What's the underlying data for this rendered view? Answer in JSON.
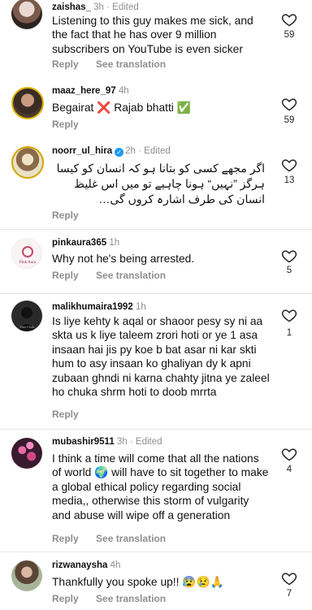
{
  "comments": [
    {
      "user": "zaishas_",
      "meta": "3h · Edited",
      "text": "Listening to this guy makes me sick, and the fact that he has over 9 million subscribers on YouTube is even sicker",
      "reply": "Reply",
      "see_translation": "See translation",
      "likes": "59"
    },
    {
      "user": "maaz_here_97",
      "meta": "4h",
      "text": "Begairat ❌ Rajab bhatti ✅",
      "reply": "Reply",
      "likes": "59"
    },
    {
      "user": "noorr_ul_hira",
      "meta": "2h · Edited",
      "text": "اگر مجھے کسی کو بتانا ہو کہ انسان کو کیسا ہرگز ”نہیں“ ہونا چاہیے تو میں اس غلیظ انسان کی طرف اشارہ کروں گی…",
      "reply": "Reply",
      "likes": "13"
    },
    {
      "user": "pinkaura365",
      "meta": "1h",
      "text": "Why not he's being arrested.",
      "reply": "Reply",
      "see_translation": "See translation",
      "likes": "5"
    },
    {
      "user": "malikhumaira1992",
      "meta": "1h",
      "text": "Is liye kehty k aqal or shaoor pesy sy ni aa skta us k liye taleem zrori hoti  or ye 1 asa insaan hai jis py koe b bat asar ni kar skti hum to asy insaan ko ghaliyan dy k apni zubaan ghndi ni karna chahty jitna ye zaleel ho chuka  shrm hoti to doob mrrta",
      "reply": "Reply",
      "likes": "1"
    },
    {
      "user": "mubashir9511",
      "meta": "3h · Edited",
      "text": "I think a time will come that all the nations of world 🌍 will have to sit together to make a global ethical policy regarding social media,, otherwise this storm of vulgarity and abuse will wipe off a generation",
      "reply": "Reply",
      "see_translation": "See translation",
      "likes": "4"
    },
    {
      "user": "rizwanaysha",
      "meta": "4h",
      "text": "Thankfully you spoke up!! 😰😢🙏",
      "reply": "Reply",
      "see_translation": "See translation",
      "likes": "7"
    }
  ],
  "colors": {
    "text": "#111111",
    "meta": "#8e8e8e",
    "verified": "#1d9bf0"
  }
}
